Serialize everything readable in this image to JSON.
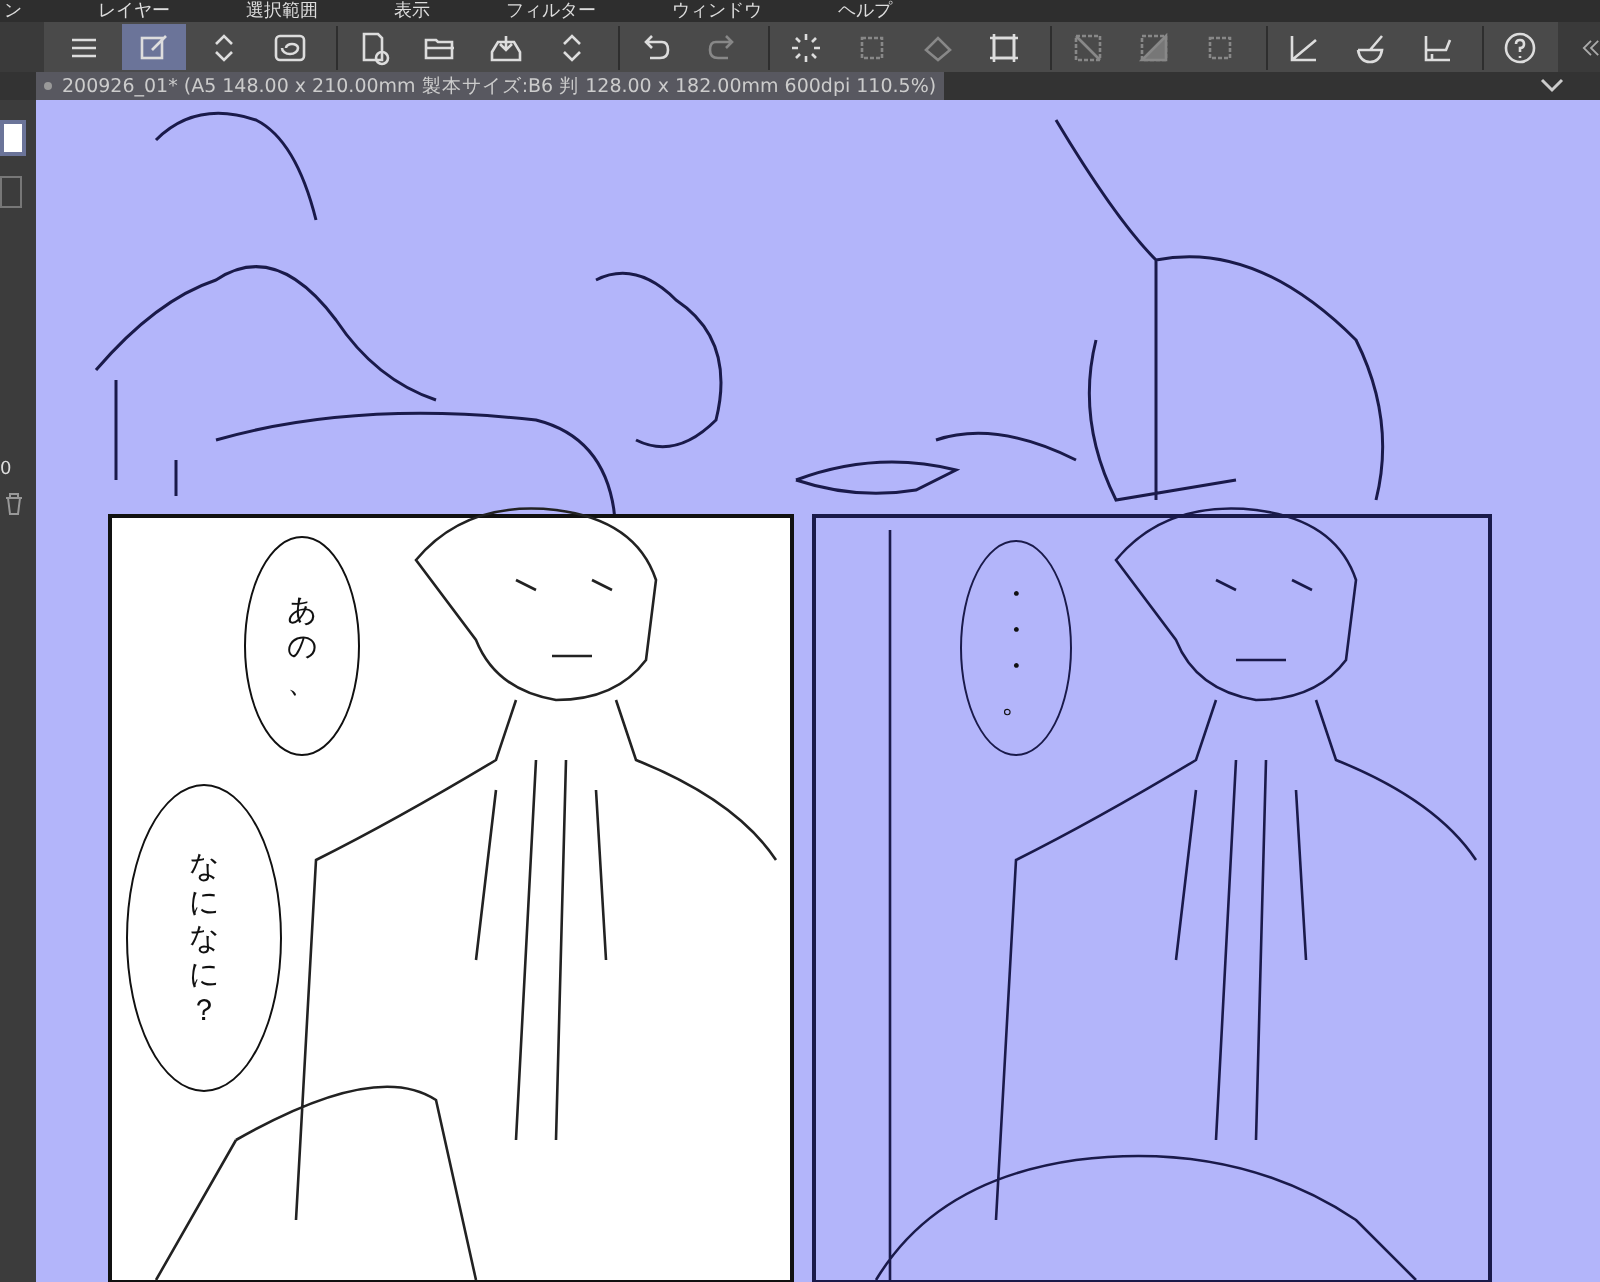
{
  "menu_bar": [
    "ン",
    "レイヤー",
    "選択範囲",
    "表示",
    "フィルター",
    "ウィンドウ",
    "ヘルプ"
  ],
  "toolbar": [
    {
      "kind": "menu",
      "selected": false,
      "disabled": false
    },
    {
      "kind": "edit",
      "selected": true,
      "disabled": false
    },
    {
      "kind": "updown",
      "selected": false,
      "disabled": false
    },
    {
      "kind": "spiral",
      "selected": false,
      "disabled": false
    },
    {
      "kind": "sep"
    },
    {
      "kind": "new",
      "selected": false,
      "disabled": false
    },
    {
      "kind": "open",
      "selected": false,
      "disabled": false
    },
    {
      "kind": "export",
      "selected": false,
      "disabled": false
    },
    {
      "kind": "updown",
      "selected": false,
      "disabled": false
    },
    {
      "kind": "sep"
    },
    {
      "kind": "undo",
      "selected": false,
      "disabled": false
    },
    {
      "kind": "redo",
      "selected": false,
      "disabled": true
    },
    {
      "kind": "sep"
    },
    {
      "kind": "spinner",
      "selected": false,
      "disabled": false
    },
    {
      "kind": "square",
      "selected": false,
      "disabled": true
    },
    {
      "kind": "fill",
      "selected": false,
      "disabled": true
    },
    {
      "kind": "transform",
      "selected": false,
      "disabled": false
    },
    {
      "kind": "sep"
    },
    {
      "kind": "deselect",
      "selected": false,
      "disabled": true
    },
    {
      "kind": "invert",
      "selected": false,
      "disabled": true
    },
    {
      "kind": "square",
      "selected": false,
      "disabled": true
    },
    {
      "kind": "sep"
    },
    {
      "kind": "ruler",
      "selected": false,
      "disabled": false
    },
    {
      "kind": "bowl",
      "selected": false,
      "disabled": false
    },
    {
      "kind": "ruler2",
      "selected": false,
      "disabled": false
    },
    {
      "kind": "sep"
    },
    {
      "kind": "help",
      "selected": false,
      "disabled": false
    }
  ],
  "document_tab": {
    "title": "200926_01* (A5 148.00 x 210.00mm 製本サイズ:B6 判 128.00 x 182.00mm 600dpi 110.5%)",
    "selected": true
  },
  "side_panel": {
    "value": "0"
  },
  "speech_bubbles": [
    {
      "text": "あの、",
      "kind": "white"
    },
    {
      "text": "なになに？",
      "kind": "white"
    },
    {
      "text": "・・・。",
      "kind": "tinted"
    }
  ]
}
